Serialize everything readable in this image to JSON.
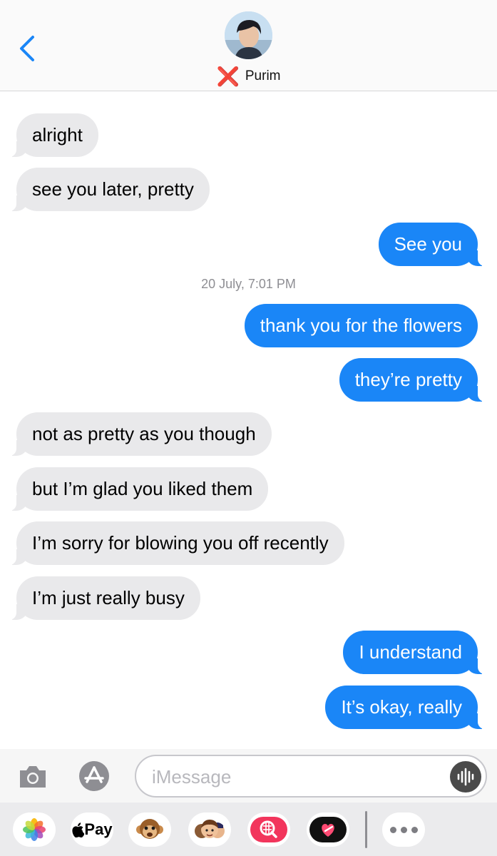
{
  "header": {
    "contact_name": "Purim",
    "contact_emoji": "❌"
  },
  "messages": [
    {
      "side": "in",
      "text": "alright"
    },
    {
      "side": "in",
      "text": "see you later, pretty"
    },
    {
      "side": "out",
      "text": "See you"
    },
    {
      "side": "out",
      "text": "thank you for the flowers"
    },
    {
      "side": "out",
      "text": "they’re pretty"
    },
    {
      "side": "in",
      "text": "not as pretty as you though"
    },
    {
      "side": "in",
      "text": "but I’m glad you liked them"
    },
    {
      "side": "in",
      "text": "I’m sorry for blowing you off recently"
    },
    {
      "side": "in",
      "text": "I’m just really busy"
    },
    {
      "side": "out",
      "text": "I understand"
    },
    {
      "side": "out",
      "text": "It’s okay, really"
    }
  ],
  "timestamp": "20 July, 7:01 PM",
  "input": {
    "placeholder": "iMessage",
    "value": ""
  },
  "apps": {
    "apple_pay_label": "Pay",
    "icons": [
      "photos-icon",
      "apple-pay-icon",
      "monkey-animoji-icon",
      "memoji-stickers-icon",
      "image-search-icon",
      "digital-touch-icon",
      "more-apps-icon"
    ]
  },
  "colors": {
    "outgoing_bubble": "#1a86f7",
    "incoming_bubble": "#e9e9eb",
    "accent": "#1a86f7"
  }
}
